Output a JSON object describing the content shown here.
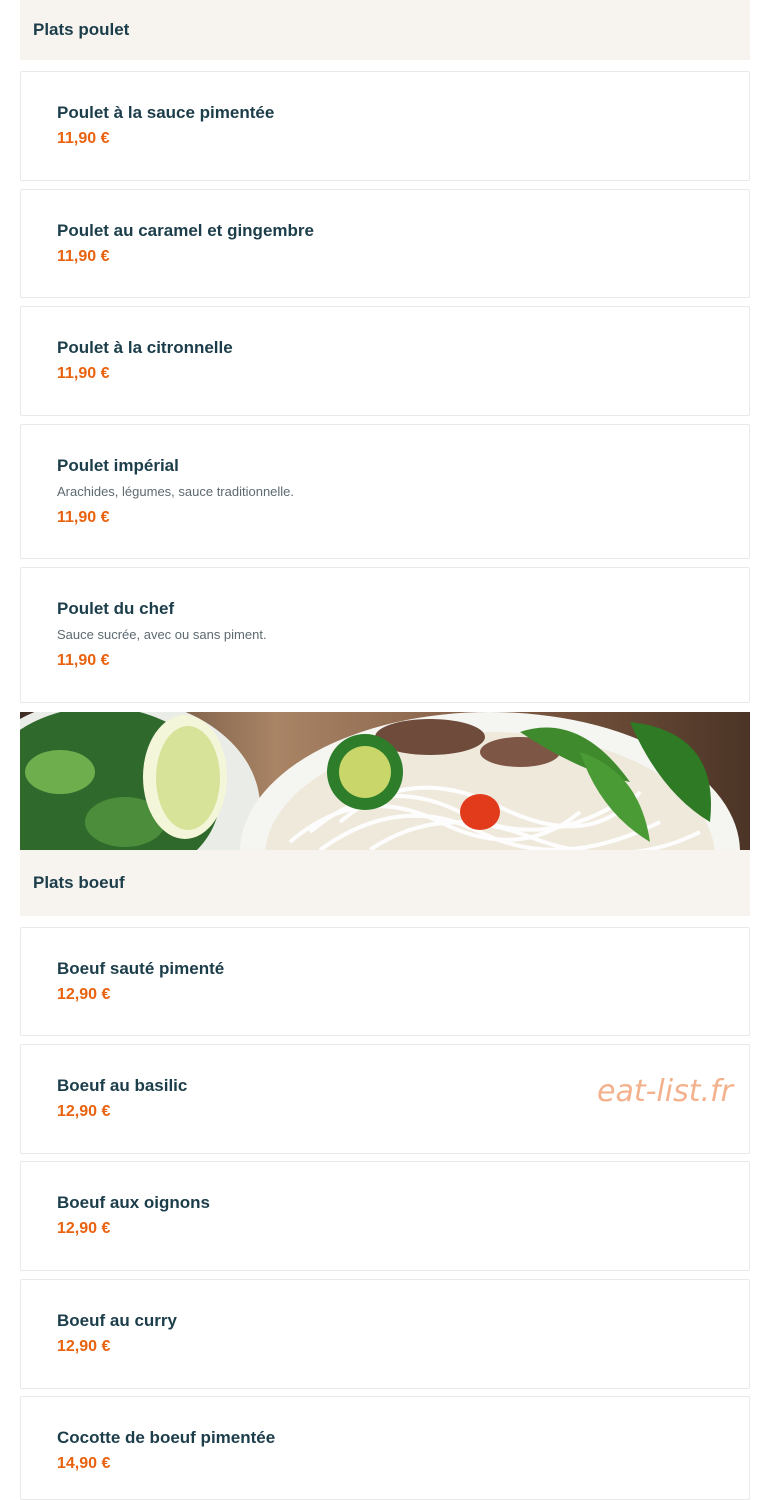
{
  "sections": {
    "poulet": {
      "title": "Plats poulet",
      "items": [
        {
          "name": "Poulet à la sauce pimentée",
          "price": "11,90 €"
        },
        {
          "name": "Poulet au caramel et gingembre",
          "price": "11,90 €"
        },
        {
          "name": "Poulet à la citronnelle",
          "price": "11,90 €"
        },
        {
          "name": "Poulet impérial",
          "description": "Arachides, légumes, sauce traditionnelle.",
          "price": "11,90 €"
        },
        {
          "name": "Poulet du chef",
          "description": "Sauce sucrée, avec ou sans piment.",
          "price": "11,90 €"
        }
      ]
    },
    "boeuf": {
      "title": "Plats boeuf",
      "items": [
        {
          "name": "Boeuf sauté pimenté",
          "price": "12,90 €"
        },
        {
          "name": "Boeuf au basilic",
          "price": "12,90 €"
        },
        {
          "name": "Boeuf aux oignons",
          "price": "12,90 €"
        },
        {
          "name": "Boeuf au curry",
          "price": "12,90 €"
        },
        {
          "name": "Cocotte de boeuf pimentée",
          "price": "14,90 €"
        }
      ]
    }
  },
  "watermark": "eat-list.fr",
  "colors": {
    "title": "#1c3d4a",
    "price": "#e8620f",
    "header_bg": "#f7f4f0",
    "watermark": "#f3b28d"
  }
}
